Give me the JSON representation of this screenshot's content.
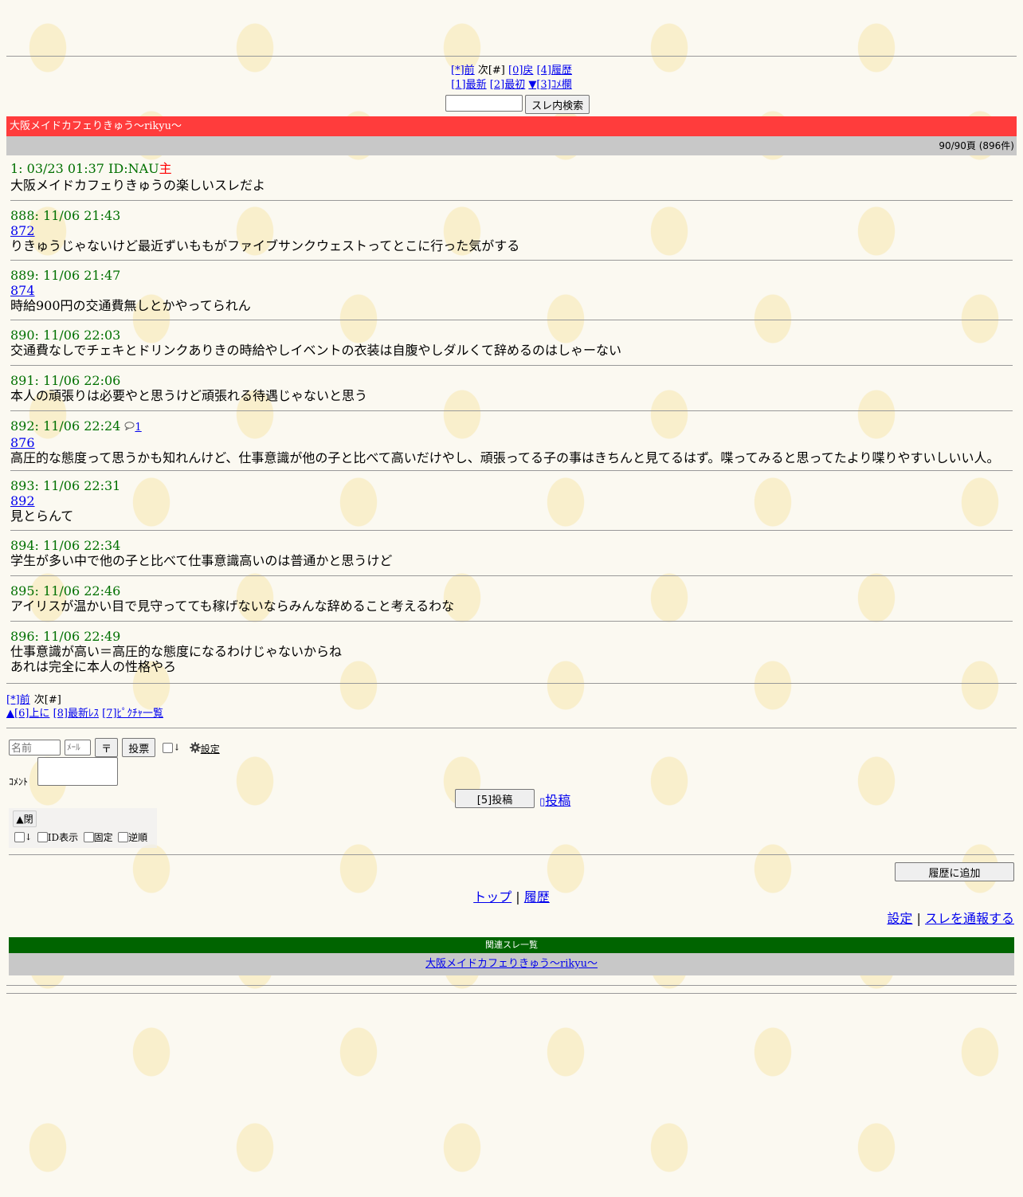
{
  "top_nav": {
    "row1": {
      "prev": "[*]前",
      "next": "次[#]",
      "back": "[0]戻",
      "history": "[4]履歴"
    },
    "row2": {
      "latest": "[1]最新",
      "first": "[2]最初",
      "comment_box": "▼[3]ｺﾒ欄"
    },
    "search_button": "スレ内検索"
  },
  "thread": {
    "title": "大阪メイドカフェりきゅう～rikyu～",
    "page_count": "90/90頁 (896件)"
  },
  "posts": [
    {
      "header": "1: 03/23 01:37 ID:NAU",
      "author": "主",
      "anchor": "",
      "reply_count": "",
      "lines": [
        "大阪メイドカフェりきゅうの楽しいスレだよ"
      ]
    },
    {
      "header": "888: 11/06 21:43",
      "author": "",
      "anchor": "872",
      "reply_count": "",
      "lines": [
        "りきゅうじゃないけど最近ずいももがファイブサンクウェストってとこに行った気がする"
      ]
    },
    {
      "header": "889: 11/06 21:47",
      "author": "",
      "anchor": "874",
      "reply_count": "",
      "lines": [
        "時給900円の交通費無しとかやってられん"
      ]
    },
    {
      "header": "890: 11/06 22:03",
      "author": "",
      "anchor": "",
      "reply_count": "",
      "lines": [
        "交通費なしでチェキとドリンクありきの時給やしイベントの衣装は自腹やしダルくて辞めるのはしゃーない"
      ]
    },
    {
      "header": "891: 11/06 22:06",
      "author": "",
      "anchor": "",
      "reply_count": "",
      "lines": [
        "本人の頑張りは必要やと思うけど頑張れる待遇じゃないと思う"
      ]
    },
    {
      "header": "892: 11/06 22:24",
      "author": "",
      "anchor": "876",
      "reply_count": "1",
      "lines": [
        "高圧的な態度って思うかも知れんけど、仕事意識が他の子と比べて高いだけやし、頑張ってる子の事はきちんと見てるはず。喋ってみると思ってたより喋りやすいしいい人。"
      ]
    },
    {
      "header": "893: 11/06 22:31",
      "author": "",
      "anchor": "892",
      "reply_count": "",
      "lines": [
        "見とらんて"
      ]
    },
    {
      "header": "894: 11/06 22:34",
      "author": "",
      "anchor": "",
      "reply_count": "",
      "lines": [
        "学生が多い中で他の子と比べて仕事意識高いのは普通かと思うけど"
      ]
    },
    {
      "header": "895: 11/06 22:46",
      "author": "",
      "anchor": "",
      "reply_count": "",
      "lines": [
        "アイリスが温かい目で見守ってても稼げないならみんな辞めること考えるわな"
      ]
    },
    {
      "header": "896: 11/06 22:49",
      "author": "",
      "anchor": "",
      "reply_count": "",
      "lines": [
        "仕事意識が高い＝高圧的な態度になるわけじゃないからね",
        "あれは完全に本人の性格やろ"
      ]
    }
  ],
  "bottom_nav": {
    "prev": "[*]前",
    "next": "次[#]",
    "up": "▲[6]上に",
    "latest_res": "[8]最新ﾚｽ",
    "picture_list": "[7]ﾋﾟｸﾁｬ一覧"
  },
  "form": {
    "name_placeholder": "名前",
    "mail_placeholder": "ﾒｰﾙ",
    "sage_button": "〒",
    "vote_button": "投票",
    "down_label": "↓",
    "settings_label": "設定",
    "comment_label": "ｺﾒﾝﾄ",
    "post_button": "[5]投稿",
    "post_link": "投稿"
  },
  "options": {
    "close_button": "▲閉",
    "down_label": "↓",
    "id_display": "ID表示",
    "fixed": "固定",
    "reverse": "逆順"
  },
  "footer": {
    "add_history_button": "履歴に追加",
    "top_link": "トップ",
    "separator": "|",
    "history_link": "履歴",
    "settings_link": "設定",
    "report_link": "スレを通報する"
  },
  "related": {
    "heading": "関連スレ一覧",
    "items": [
      "大阪メイドカフェりきゅう～rikyu～"
    ]
  }
}
